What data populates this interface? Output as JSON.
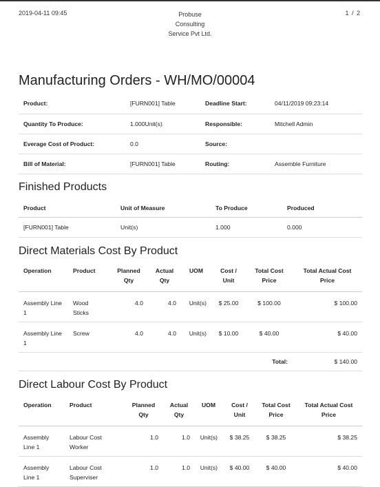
{
  "header": {
    "datetime": "2019-04-11 09:45",
    "company_line1": "Probuse",
    "company_line2": "Consulting",
    "company_line3": "Service Pvt Ltd.",
    "page": "1 / 2"
  },
  "title": "Manufacturing Orders - WH/MO/00004",
  "info": [
    {
      "l1": "Product:",
      "v1": "[FURN001] Table",
      "l2": "Deadline Start:",
      "v2": "04/11/2019 09:23:14"
    },
    {
      "l1": "Quantity To Produce:",
      "v1": "1.000Unit(s)",
      "l2": "Responsible:",
      "v2": "Mitchell Admin"
    },
    {
      "l1": "Everage Cost of Product:",
      "v1": "0.0",
      "l2": "Source:",
      "v2": ""
    },
    {
      "l1": "Bill of Material:",
      "v1": "[FURN001] Table",
      "l2": "Routing:",
      "v2": "Assemble Furniture"
    }
  ],
  "finished": {
    "title": "Finished Products",
    "headers": [
      "Product",
      "Unit of Measure",
      "To Produce",
      "Produced"
    ],
    "row": [
      "[FURN001] Table",
      "Unit(s)",
      "1.000",
      "0.000"
    ]
  },
  "materials": {
    "title": "Direct Materials Cost By Product",
    "headers": [
      "Operation",
      "Product",
      "Planned Qty",
      "Actual Qty",
      "UOM",
      "Cost / Unit",
      "Total Cost Price",
      "Total Actual Cost Price"
    ],
    "rows": [
      [
        "Assembly Line 1",
        "Wood Sticks",
        "4.0",
        "4.0",
        "Unit(s)",
        "$ 25.00",
        "$ 100.00",
        "$ 100.00"
      ],
      [
        "Assembly Line 1",
        "Screw",
        "4.0",
        "4.0",
        "Unit(s)",
        "$ 10.00",
        "$ 40.00",
        "$ 40.00"
      ]
    ],
    "total_label": "Total:",
    "total_value": "$ 140.00"
  },
  "labour": {
    "title": "Direct Labour Cost By Product",
    "headers": [
      "Operation",
      "Product",
      "Planned Qty",
      "Actual Qty",
      "UOM",
      "Cost / Unit",
      "Total Cost Price",
      "Total Actual Cost Price"
    ],
    "rows": [
      [
        "Assembly Line 1",
        "Labour Cost Worker",
        "1.0",
        "1.0",
        "Unit(s)",
        "$ 38.25",
        "$ 38.25",
        "$ 38.25"
      ],
      [
        "Assembly Line 1",
        "Labour Cost Superviser",
        "1.0",
        "1.0",
        "Unit(s)",
        "$ 40.00",
        "$ 40.00",
        "$ 40.00"
      ]
    ]
  }
}
